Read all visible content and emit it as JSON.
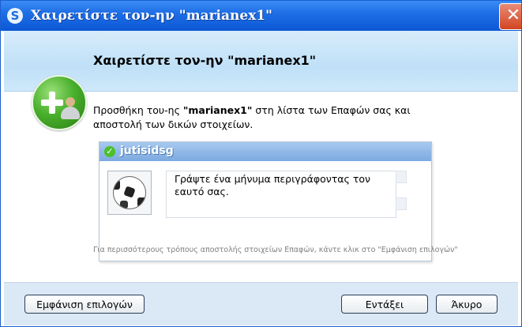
{
  "window": {
    "title": "Χαιρετίστε τον-ην \"marianex1\"",
    "close_symbol": "✕",
    "app_icon": "S"
  },
  "header": {
    "title": "Χαιρετίστε τον-ην \"marianex1\"",
    "icon": "add-contact-icon"
  },
  "description": {
    "prefix": "Προσθήκη του-ης ",
    "contact": "\"marianex1\"",
    "suffix": " στη λίστα των Επαφών σας και αποστολή των δικών στοιχείων."
  },
  "card": {
    "name": "jutisidsg",
    "status_icon": "online-check-icon",
    "status_symbol": "✓",
    "avatar": "soccer-ball-avatar",
    "message": "Γράψτε ένα μήνυμα περιγράφοντας τον εαυτό σας."
  },
  "footer_note": "Για περισσότερους τρόπους αποστολής στοιχείων Επαφών, κάντε κλικ στο \"Εμφάνιση επιλογών\"",
  "buttons": {
    "options": "Εμφάνιση επιλογών",
    "ok": "Εντάξει",
    "cancel": "Άκυρο"
  },
  "colors": {
    "titlebar": "#1f6fe6",
    "accent_green": "#49b02c",
    "close_red": "#d24520",
    "bottom_band": "#dbe8f5"
  }
}
